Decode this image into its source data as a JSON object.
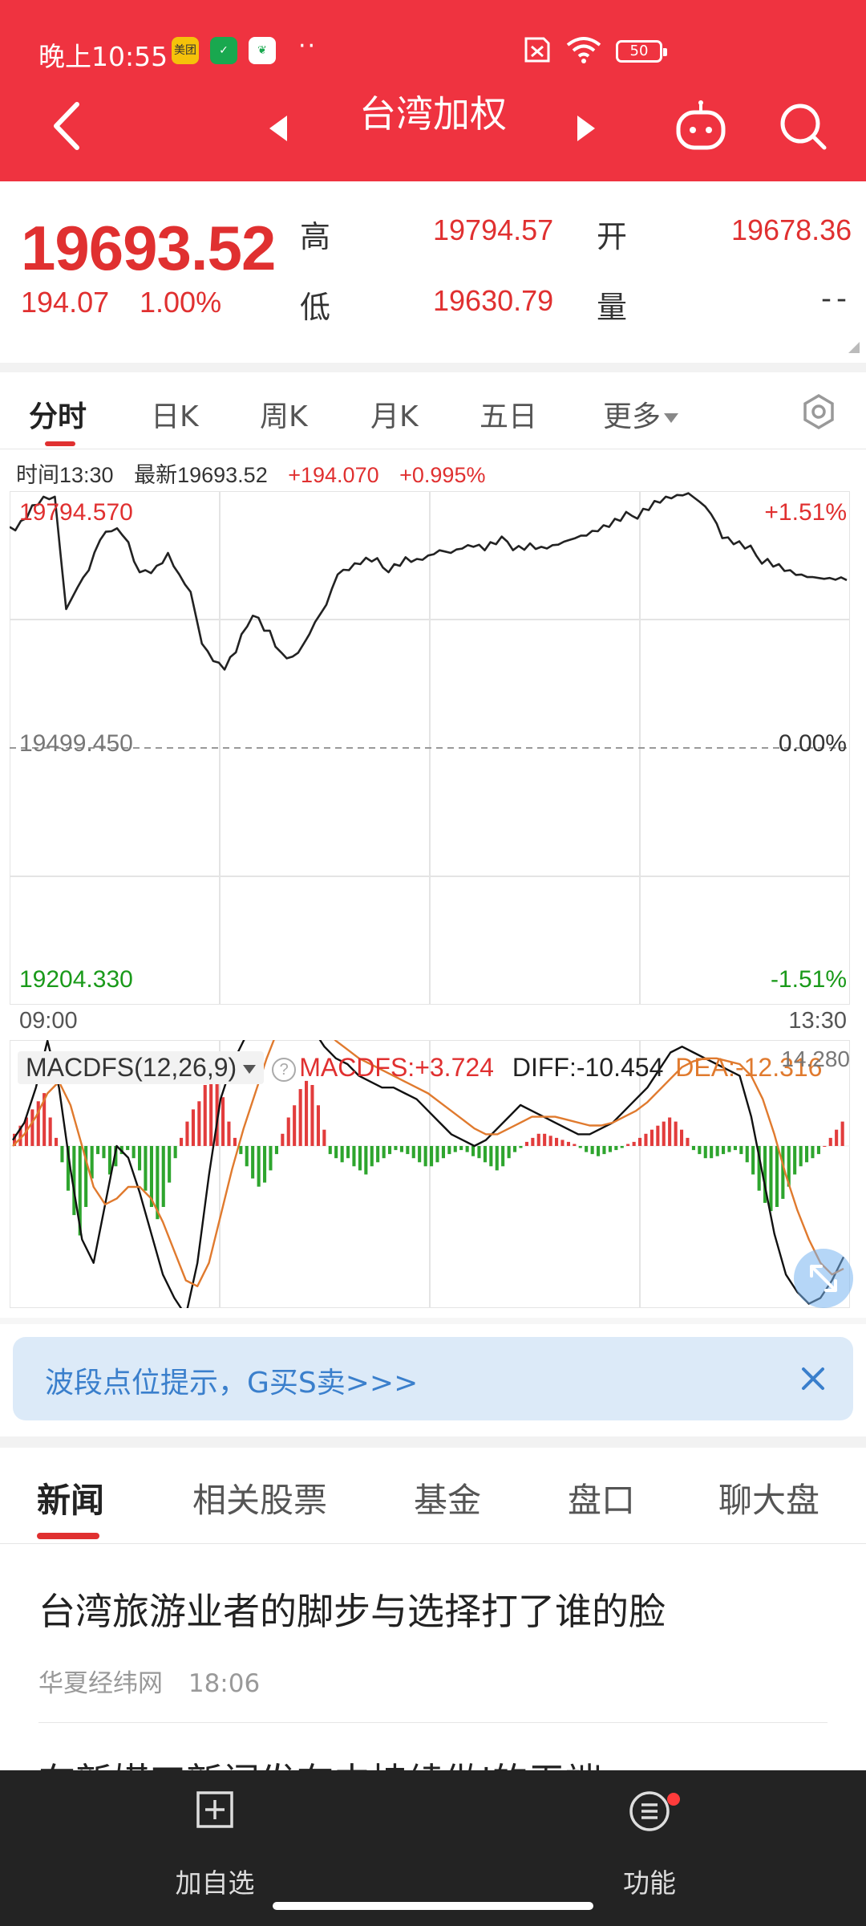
{
  "status_bar": {
    "time": "晚上10:55",
    "apps": [
      "美团",
      "shield-app",
      "leaf-app"
    ],
    "dots": "··",
    "battery": "50"
  },
  "header": {
    "title": "台湾加权",
    "icons": [
      "back-chevron-icon",
      "prev-triangle-icon",
      "next-triangle-icon",
      "robot-icon",
      "search-icon"
    ]
  },
  "quote": {
    "price": "19693.52",
    "change": "194.07",
    "change_pct": "1.00%",
    "high_label": "高",
    "high": "19794.57",
    "low_label": "低",
    "low": "19630.79",
    "open_label": "开",
    "open": "19678.36",
    "volume_label": "量",
    "volume": "--"
  },
  "chart_tabs": {
    "items": [
      "分时",
      "日K",
      "周K",
      "月K",
      "五日",
      "更多"
    ],
    "active": 0
  },
  "info_line": {
    "time": "时间13:30",
    "latest": "最新19693.52",
    "change": "+194.070",
    "change_pct": "+0.995%"
  },
  "chart_data": [
    {
      "type": "line",
      "title": "",
      "x_start": "09:00",
      "x_end": "13:30",
      "ylim": [
        19204.33,
        19794.57
      ],
      "y_labels": {
        "top": "19794.570",
        "mid": "19499.450",
        "bottom": "19204.330"
      },
      "pct_labels": {
        "top": "+1.51%",
        "mid": "0.00%",
        "bottom": "-1.51%"
      },
      "grid": true,
      "series": [
        {
          "values": [
            19755,
            19762,
            19780,
            19790,
            19790,
            19660,
            19685,
            19705,
            19740,
            19750,
            19745,
            19715,
            19705,
            19710,
            19725,
            19700,
            19680,
            19620,
            19600,
            19590,
            19610,
            19640,
            19650,
            19635,
            19610,
            19605,
            19620,
            19645,
            19665,
            19700,
            19705,
            19712,
            19715,
            19708,
            19712,
            19720,
            19718,
            19722,
            19728,
            19725,
            19730,
            19732,
            19728,
            19735,
            19738,
            19733,
            19736,
            19732,
            19734,
            19738,
            19742,
            19745,
            19750,
            19755,
            19762,
            19768,
            19776,
            19785,
            19790,
            19792,
            19794,
            19784,
            19770,
            19742,
            19735,
            19730,
            19722,
            19718,
            19712,
            19705,
            19700,
            19697,
            19695,
            19694,
            19693.52
          ]
        }
      ]
    },
    {
      "type": "bar",
      "title": "",
      "name": "MACDFS(12,26,9)",
      "legend": {
        "macdfs": "MACDFS:+3.724",
        "diff": "DIFF:-10.454",
        "dea": "DEA:-12.316"
      },
      "right_label": "14.280",
      "ylim": [
        -60,
        60
      ],
      "histogram": [
        6,
        10,
        14,
        18,
        22,
        26,
        14,
        4,
        -8,
        -22,
        -34,
        -44,
        -30,
        -16,
        -4,
        -6,
        -14,
        -10,
        -4,
        -2,
        -6,
        -12,
        -22,
        -30,
        -36,
        -30,
        -18,
        -6,
        4,
        12,
        18,
        22,
        30,
        36,
        34,
        24,
        12,
        4,
        -4,
        -10,
        -16,
        -20,
        -18,
        -12,
        -4,
        6,
        14,
        20,
        28,
        32,
        30,
        20,
        8,
        -4,
        -6,
        -8,
        -6,
        -10,
        -12,
        -14,
        -10,
        -8,
        -6,
        -4,
        -2,
        -3,
        -4,
        -6,
        -8,
        -10,
        -10,
        -8,
        -6,
        -4,
        -3,
        -2,
        -3,
        -5,
        -6,
        -8,
        -10,
        -12,
        -10,
        -6,
        -3,
        -1,
        2,
        4,
        6,
        6,
        5,
        4,
        3,
        2,
        1,
        -1,
        -3,
        -4,
        -5,
        -4,
        -3,
        -2,
        -1,
        1,
        2,
        4,
        6,
        8,
        10,
        12,
        14,
        12,
        8,
        4,
        -2,
        -4,
        -6,
        -6,
        -5,
        -4,
        -3,
        -2,
        -4,
        -8,
        -14,
        -22,
        -28,
        -32,
        -30,
        -26,
        -20,
        -14,
        -10,
        -8,
        -6,
        -4,
        0,
        4,
        8,
        12
      ],
      "series": [
        {
          "key": "diff",
          "values": [
            2,
            8,
            20,
            36,
            20,
            -8,
            -32,
            -40,
            -20,
            0,
            -4,
            -16,
            -30,
            -44,
            -52,
            -58,
            -40,
            -10,
            16,
            28,
            36,
            44,
            54,
            60,
            52,
            44,
            40,
            34,
            30,
            28,
            24,
            22,
            20,
            20,
            18,
            16,
            12,
            8,
            4,
            2,
            0,
            2,
            6,
            10,
            14,
            12,
            10,
            8,
            6,
            4,
            4,
            6,
            8,
            12,
            16,
            20,
            26,
            32,
            34,
            32,
            30,
            28,
            26,
            24,
            10,
            -10,
            -30,
            -44,
            -50,
            -54,
            -52,
            -46,
            -38
          ]
        },
        {
          "key": "dea",
          "values": [
            0,
            4,
            10,
            18,
            22,
            14,
            0,
            -14,
            -20,
            -18,
            -14,
            -14,
            -18,
            -26,
            -36,
            -46,
            -48,
            -40,
            -24,
            -8,
            6,
            18,
            30,
            40,
            46,
            46,
            44,
            40,
            36,
            33,
            30,
            28,
            26,
            24,
            22,
            20,
            18,
            15,
            12,
            9,
            6,
            4,
            4,
            6,
            8,
            10,
            10,
            10,
            9,
            8,
            7,
            7,
            8,
            10,
            12,
            15,
            19,
            23,
            27,
            29,
            30,
            30,
            29,
            28,
            24,
            16,
            4,
            -10,
            -22,
            -32,
            -40,
            -44,
            -42
          ]
        }
      ]
    }
  ],
  "banner": {
    "text": "波段点位提示，G买S卖>>>"
  },
  "news_tabs": {
    "items": [
      "新闻",
      "相关股票",
      "基金",
      "盘口",
      "聊大盘"
    ],
    "active": 0
  },
  "news": {
    "title": "台湾旅游业者的脚步与选择打了谁的脸",
    "source": "华夏经纬网",
    "time": "18:06",
    "partial_title": "在新媒工新闻发布中持续做'的无端"
  },
  "bottom_bar": {
    "add_label": "加自选",
    "func_label": "功能"
  },
  "colors": {
    "brand_red": "#ef3340",
    "up_red": "#e03030",
    "down_green": "#1a9a1a",
    "dea_orange": "#e07a2e",
    "banner_blue": "#3a7fcc"
  }
}
